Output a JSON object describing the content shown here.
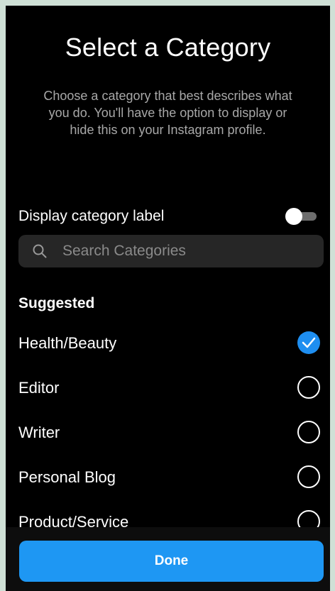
{
  "header": {
    "title": "Select a Category",
    "subtitle": "Choose a category that best describes what you do. You'll have the option to display or hide this on your Instagram profile."
  },
  "display_toggle": {
    "label": "Display category label",
    "on": false
  },
  "search": {
    "placeholder": "Search Categories",
    "value": ""
  },
  "suggested": {
    "title": "Suggested",
    "items": [
      {
        "label": "Health/Beauty",
        "selected": true
      },
      {
        "label": "Editor",
        "selected": false
      },
      {
        "label": "Writer",
        "selected": false
      },
      {
        "label": "Personal Blog",
        "selected": false
      },
      {
        "label": "Product/Service",
        "selected": false
      }
    ]
  },
  "footer": {
    "done_label": "Done"
  },
  "colors": {
    "background": "#000000",
    "accent": "#1e97f3",
    "muted_text": "#a8a8a8",
    "search_bg": "#262626"
  },
  "icons": {
    "search": "search-icon",
    "check": "check-icon"
  }
}
